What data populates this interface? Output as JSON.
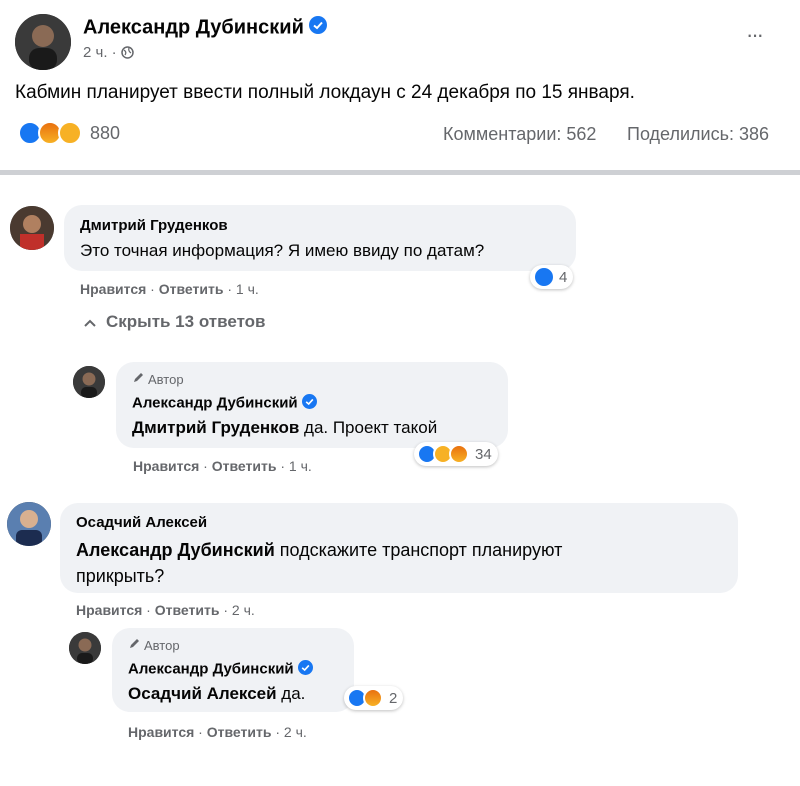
{
  "post": {
    "author": "Александр Дубинский",
    "time": "2 ч. ·",
    "text": "Кабмин планирует ввести полный локдаун с 24 декабря по 15 января.",
    "reactions_count": "880",
    "comments": "Комментарии: 562",
    "shares": "Поделились: 386",
    "more_label": "···"
  },
  "comments": [
    {
      "author": "Дмитрий Груденков",
      "text": "Это точная информация? Я имею ввиду по датам?",
      "reactions": "4",
      "like": "Нравится",
      "reply": "Ответить",
      "time": "1 ч.",
      "hide_replies": "Скрыть 13 ответов"
    },
    {
      "author_badge": "Автор",
      "author": "Александр Дубинский",
      "mention": "Дмитрий Груденков",
      "text": " да. Проект такой",
      "reactions": "34",
      "like": "Нравится",
      "reply": "Ответить",
      "time": "1 ч."
    },
    {
      "author": "Осадчий Алексей",
      "mention": "Александр Дубинский",
      "text": " подскажите транспорт планируют",
      "text2": "прикрыть?",
      "like": "Нравится",
      "reply": "Ответить",
      "time": "2 ч."
    },
    {
      "author_badge": "Автор",
      "author": "Александр Дубинский",
      "mention": "Осадчий Алексей",
      "text": " да.",
      "reactions": "2",
      "like": "Нравится",
      "reply": "Ответить",
      "time": "2 ч."
    }
  ],
  "colors": {
    "accent": "#1877f2",
    "bubble": "#f0f2f5",
    "muted": "#65676b",
    "divider": "#ced0d4"
  }
}
